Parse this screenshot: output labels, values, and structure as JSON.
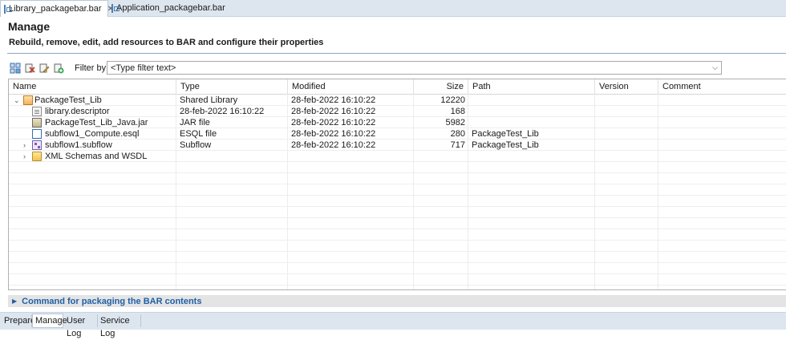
{
  "editor_tabs": [
    {
      "label": "Library_packagebar.bar",
      "active": true,
      "closable": true,
      "icon": "bar-file-icon"
    },
    {
      "label": "Application_packagebar.bar",
      "active": false,
      "closable": false,
      "icon": "bar-file-icon"
    }
  ],
  "header": {
    "title": "Manage",
    "subtitle": "Rebuild, remove, edit, add resources to BAR and configure their properties"
  },
  "toolbar": {
    "icons": [
      "rebuild-icon",
      "remove-icon",
      "edit-icon",
      "add-resource-icon"
    ],
    "filter_label": "Filter by:",
    "filter_placeholder": "<Type filter text>",
    "filter_value": ""
  },
  "table": {
    "columns": [
      "Name",
      "Type",
      "Modified",
      "Size",
      "Path",
      "Version",
      "Comment"
    ],
    "rows": [
      {
        "name": "PackageTest_Lib",
        "type": "Shared Library",
        "modified": "28-feb-2022  16:10:22",
        "size": "12220",
        "path": "",
        "version": "",
        "comment": "",
        "level": 0,
        "twisty": "expanded",
        "icon": "library-icon"
      },
      {
        "name": "library.descriptor",
        "type": "28-feb-2022  16:10:22",
        "modified": "28-feb-2022  16:10:22",
        "size": "168",
        "path": "",
        "version": "",
        "comment": "",
        "level": 1,
        "twisty": "none",
        "icon": "descriptor-file-icon"
      },
      {
        "name": "PackageTest_Lib_Java.jar",
        "type": "JAR file",
        "modified": "28-feb-2022  16:10:22",
        "size": "5982",
        "path": "",
        "version": "",
        "comment": "",
        "level": 1,
        "twisty": "none",
        "icon": "jar-file-icon"
      },
      {
        "name": "subflow1_Compute.esql",
        "type": "ESQL file",
        "modified": "28-feb-2022  16:10:22",
        "size": "280",
        "path": "PackageTest_Lib",
        "version": "",
        "comment": "",
        "level": 1,
        "twisty": "none",
        "icon": "esql-file-icon"
      },
      {
        "name": "subflow1.subflow",
        "type": "Subflow",
        "modified": "28-feb-2022  16:10:22",
        "size": "717",
        "path": "PackageTest_Lib",
        "version": "",
        "comment": "",
        "level": 1,
        "twisty": "collapsed",
        "icon": "subflow-icon"
      },
      {
        "name": "XML Schemas and WSDL",
        "type": "",
        "modified": "",
        "size": "",
        "path": "",
        "version": "",
        "comment": "",
        "level": 1,
        "twisty": "collapsed",
        "icon": "folder-icon"
      }
    ]
  },
  "command_section": {
    "label": "Command for packaging the BAR contents",
    "collapsed": true
  },
  "bottom_tabs": [
    {
      "label": "Prepare",
      "active": false
    },
    {
      "label": "Manage",
      "active": true
    },
    {
      "label": "User Log",
      "active": false
    },
    {
      "label": "Service Log",
      "active": false
    }
  ],
  "colors": {
    "accent_link": "#1f5fa6",
    "tab_bar": "#dde6ef",
    "header_rule": "#8fa7c3"
  }
}
